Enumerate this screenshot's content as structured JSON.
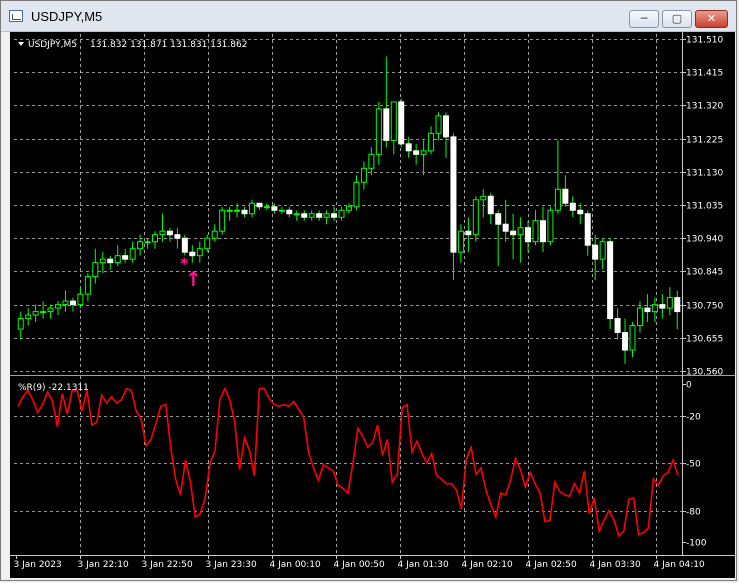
{
  "window": {
    "title": "USDJPY,M5",
    "buttons": {
      "minimize": "─",
      "maximize": "▢",
      "close": "✕"
    }
  },
  "chart_header": {
    "symbol": "USDJPY,M5",
    "ohlc": "131.832 131.871 131.831 131.862"
  },
  "indicator": {
    "label": "%R(9) -22.1311"
  },
  "colors": {
    "background": "#000000",
    "grid": "#c8c8c8",
    "candle": "#00ff00",
    "indicator_line": "#ff0000",
    "signal": "#ff1493"
  },
  "signal": {
    "star_glyph": "*",
    "arrow_glyph": "↑"
  },
  "chart_data": [
    {
      "type": "candlestick",
      "title": "USDJPY,M5",
      "ylim": [
        130.56,
        131.51
      ],
      "y_ticks": [
        "131.510",
        "131.415",
        "131.320",
        "131.225",
        "131.130",
        "131.035",
        "130.940",
        "130.845",
        "130.750",
        "130.655",
        "130.560"
      ],
      "x_ticks": [
        "3 Jan 2023",
        "3 Jan 22:10",
        "3 Jan 22:50",
        "3 Jan 23:30",
        "4 Jan 00:10",
        "4 Jan 00:50",
        "4 Jan 01:30",
        "4 Jan 02:10",
        "4 Jan 02:50",
        "4 Jan 03:30",
        "4 Jan 04:10"
      ],
      "candles": [
        {
          "o": 130.68,
          "h": 130.73,
          "l": 130.65,
          "c": 130.71
        },
        {
          "o": 130.71,
          "h": 130.74,
          "l": 130.69,
          "c": 130.72
        },
        {
          "o": 130.72,
          "h": 130.75,
          "l": 130.7,
          "c": 130.73
        },
        {
          "o": 130.73,
          "h": 130.76,
          "l": 130.71,
          "c": 130.73
        },
        {
          "o": 130.73,
          "h": 130.75,
          "l": 130.71,
          "c": 130.74
        },
        {
          "o": 130.74,
          "h": 130.76,
          "l": 130.72,
          "c": 130.75
        },
        {
          "o": 130.75,
          "h": 130.79,
          "l": 130.73,
          "c": 130.76
        },
        {
          "o": 130.76,
          "h": 130.77,
          "l": 130.73,
          "c": 130.75
        },
        {
          "o": 130.75,
          "h": 130.8,
          "l": 130.74,
          "c": 130.78
        },
        {
          "o": 130.78,
          "h": 130.84,
          "l": 130.76,
          "c": 130.83
        },
        {
          "o": 130.83,
          "h": 130.91,
          "l": 130.81,
          "c": 130.87
        },
        {
          "o": 130.87,
          "h": 130.9,
          "l": 130.84,
          "c": 130.88
        },
        {
          "o": 130.88,
          "h": 130.89,
          "l": 130.85,
          "c": 130.87
        },
        {
          "o": 130.87,
          "h": 130.92,
          "l": 130.86,
          "c": 130.89
        },
        {
          "o": 130.89,
          "h": 130.91,
          "l": 130.87,
          "c": 130.88
        },
        {
          "o": 130.88,
          "h": 130.93,
          "l": 130.87,
          "c": 130.91
        },
        {
          "o": 130.91,
          "h": 130.95,
          "l": 130.89,
          "c": 130.93
        },
        {
          "o": 130.93,
          "h": 130.94,
          "l": 130.91,
          "c": 130.93
        },
        {
          "o": 130.93,
          "h": 130.96,
          "l": 130.91,
          "c": 130.95
        },
        {
          "o": 130.95,
          "h": 131.01,
          "l": 130.93,
          "c": 130.96
        },
        {
          "o": 130.96,
          "h": 130.97,
          "l": 130.93,
          "c": 130.95
        },
        {
          "o": 130.95,
          "h": 130.97,
          "l": 130.91,
          "c": 130.94
        },
        {
          "o": 130.94,
          "h": 130.95,
          "l": 130.89,
          "c": 130.9
        },
        {
          "o": 130.9,
          "h": 130.92,
          "l": 130.87,
          "c": 130.89
        },
        {
          "o": 130.89,
          "h": 130.93,
          "l": 130.87,
          "c": 130.91
        },
        {
          "o": 130.91,
          "h": 130.95,
          "l": 130.9,
          "c": 130.94
        },
        {
          "o": 130.94,
          "h": 130.98,
          "l": 130.93,
          "c": 130.96
        },
        {
          "o": 130.96,
          "h": 131.03,
          "l": 130.95,
          "c": 131.02
        },
        {
          "o": 131.02,
          "h": 131.03,
          "l": 130.99,
          "c": 131.02
        },
        {
          "o": 131.02,
          "h": 131.04,
          "l": 131.0,
          "c": 131.02
        },
        {
          "o": 131.02,
          "h": 131.03,
          "l": 131.0,
          "c": 131.01
        },
        {
          "o": 131.01,
          "h": 131.05,
          "l": 131.0,
          "c": 131.04
        },
        {
          "o": 131.04,
          "h": 131.04,
          "l": 131.02,
          "c": 131.03
        },
        {
          "o": 131.03,
          "h": 131.04,
          "l": 131.02,
          "c": 131.03
        },
        {
          "o": 131.03,
          "h": 131.04,
          "l": 131.01,
          "c": 131.02
        },
        {
          "o": 131.02,
          "h": 131.03,
          "l": 131.01,
          "c": 131.02
        },
        {
          "o": 131.02,
          "h": 131.03,
          "l": 131.0,
          "c": 131.01
        },
        {
          "o": 131.01,
          "h": 131.02,
          "l": 130.99,
          "c": 131.01
        },
        {
          "o": 131.01,
          "h": 131.02,
          "l": 130.99,
          "c": 131.0
        },
        {
          "o": 131.0,
          "h": 131.02,
          "l": 130.99,
          "c": 131.01
        },
        {
          "o": 131.01,
          "h": 131.02,
          "l": 130.99,
          "c": 131.0
        },
        {
          "o": 131.0,
          "h": 131.02,
          "l": 130.98,
          "c": 131.01
        },
        {
          "o": 131.01,
          "h": 131.03,
          "l": 130.99,
          "c": 131.0
        },
        {
          "o": 131.0,
          "h": 131.03,
          "l": 130.99,
          "c": 131.02
        },
        {
          "o": 131.02,
          "h": 131.04,
          "l": 131.01,
          "c": 131.03
        },
        {
          "o": 131.03,
          "h": 131.12,
          "l": 131.02,
          "c": 131.1
        },
        {
          "o": 131.1,
          "h": 131.16,
          "l": 131.08,
          "c": 131.14
        },
        {
          "o": 131.14,
          "h": 131.2,
          "l": 131.12,
          "c": 131.18
        },
        {
          "o": 131.18,
          "h": 131.33,
          "l": 131.15,
          "c": 131.31
        },
        {
          "o": 131.31,
          "h": 131.46,
          "l": 131.2,
          "c": 131.22
        },
        {
          "o": 131.22,
          "h": 131.33,
          "l": 131.18,
          "c": 131.33
        },
        {
          "o": 131.33,
          "h": 131.34,
          "l": 131.2,
          "c": 131.21
        },
        {
          "o": 131.21,
          "h": 131.23,
          "l": 131.17,
          "c": 131.19
        },
        {
          "o": 131.19,
          "h": 131.21,
          "l": 131.15,
          "c": 131.18
        },
        {
          "o": 131.18,
          "h": 131.22,
          "l": 131.12,
          "c": 131.19
        },
        {
          "o": 131.19,
          "h": 131.26,
          "l": 131.18,
          "c": 131.24
        },
        {
          "o": 131.24,
          "h": 131.3,
          "l": 131.22,
          "c": 131.29
        },
        {
          "o": 131.29,
          "h": 131.3,
          "l": 131.17,
          "c": 131.23
        },
        {
          "o": 131.23,
          "h": 131.24,
          "l": 130.82,
          "c": 130.9
        },
        {
          "o": 130.9,
          "h": 130.98,
          "l": 130.87,
          "c": 130.96
        },
        {
          "o": 130.96,
          "h": 131.0,
          "l": 130.9,
          "c": 130.95
        },
        {
          "o": 130.95,
          "h": 131.06,
          "l": 130.93,
          "c": 131.05
        },
        {
          "o": 131.05,
          "h": 131.08,
          "l": 131.0,
          "c": 131.06
        },
        {
          "o": 131.06,
          "h": 131.07,
          "l": 130.98,
          "c": 131.01
        },
        {
          "o": 131.01,
          "h": 131.02,
          "l": 130.86,
          "c": 130.98
        },
        {
          "o": 130.98,
          "h": 131.05,
          "l": 130.93,
          "c": 130.96
        },
        {
          "o": 130.96,
          "h": 131.01,
          "l": 130.88,
          "c": 130.95
        },
        {
          "o": 130.95,
          "h": 131.0,
          "l": 130.87,
          "c": 130.97
        },
        {
          "o": 130.97,
          "h": 130.99,
          "l": 130.9,
          "c": 130.93
        },
        {
          "o": 130.93,
          "h": 131.02,
          "l": 130.92,
          "c": 130.99
        },
        {
          "o": 130.99,
          "h": 131.03,
          "l": 130.9,
          "c": 130.93
        },
        {
          "o": 130.93,
          "h": 131.03,
          "l": 130.92,
          "c": 131.02
        },
        {
          "o": 131.02,
          "h": 131.22,
          "l": 131.01,
          "c": 131.08
        },
        {
          "o": 131.08,
          "h": 131.12,
          "l": 131.03,
          "c": 131.04
        },
        {
          "o": 131.04,
          "h": 131.06,
          "l": 131.0,
          "c": 131.02
        },
        {
          "o": 131.02,
          "h": 131.04,
          "l": 130.98,
          "c": 131.01
        },
        {
          "o": 131.01,
          "h": 131.02,
          "l": 130.89,
          "c": 130.92
        },
        {
          "o": 130.92,
          "h": 130.95,
          "l": 130.82,
          "c": 130.88
        },
        {
          "o": 130.88,
          "h": 130.94,
          "l": 130.85,
          "c": 130.93
        },
        {
          "o": 130.93,
          "h": 130.94,
          "l": 130.68,
          "c": 130.71
        },
        {
          "o": 130.71,
          "h": 130.74,
          "l": 130.65,
          "c": 130.67
        },
        {
          "o": 130.67,
          "h": 130.71,
          "l": 130.58,
          "c": 130.62
        },
        {
          "o": 130.62,
          "h": 130.7,
          "l": 130.6,
          "c": 130.69
        },
        {
          "o": 130.69,
          "h": 130.76,
          "l": 130.67,
          "c": 130.74
        },
        {
          "o": 130.74,
          "h": 130.78,
          "l": 130.7,
          "c": 130.73
        },
        {
          "o": 130.73,
          "h": 130.77,
          "l": 130.7,
          "c": 130.75
        },
        {
          "o": 130.75,
          "h": 130.78,
          "l": 130.71,
          "c": 130.74
        },
        {
          "o": 130.74,
          "h": 130.8,
          "l": 130.72,
          "c": 130.77
        },
        {
          "o": 130.77,
          "h": 130.79,
          "l": 130.68,
          "c": 130.73
        }
      ]
    },
    {
      "type": "line",
      "title": "%R(9) -22.1311",
      "ylim": [
        -103,
        0
      ],
      "y_ticks": [
        "0",
        "-20",
        "-50",
        "-80",
        "-100"
      ],
      "series": [
        {
          "name": "%R(9)",
          "values": [
            -14,
            -8,
            -4,
            -10,
            -18,
            -13,
            -5,
            -11,
            -27,
            -6,
            -19,
            -4,
            -4,
            -17,
            -4,
            -26,
            -24,
            -7,
            -12,
            -8,
            -12,
            -10,
            -3,
            -4,
            -17,
            -22,
            -39,
            -35,
            -25,
            -14,
            -13,
            -40,
            -60,
            -70,
            -48,
            -62,
            -84,
            -82,
            -72,
            -50,
            -42,
            -10,
            -3,
            -10,
            -24,
            -54,
            -34,
            -42,
            -58,
            -3,
            -3,
            -9,
            -13,
            -14,
            -13,
            -14,
            -11,
            -16,
            -21,
            -43,
            -53,
            -61,
            -51,
            -53,
            -55,
            -64,
            -66,
            -69,
            -50,
            -28,
            -33,
            -40,
            -37,
            -26,
            -45,
            -35,
            -62,
            -57,
            -15,
            -13,
            -43,
            -36,
            -44,
            -50,
            -44,
            -58,
            -60,
            -63,
            -63,
            -67,
            -79,
            -48,
            -40,
            -57,
            -53,
            -67,
            -76,
            -84,
            -69,
            -70,
            -61,
            -47,
            -54,
            -65,
            -56,
            -63,
            -69,
            -87,
            -86,
            -62,
            -68,
            -70,
            -71,
            -63,
            -69,
            -55,
            -82,
            -72,
            -93,
            -86,
            -80,
            -86,
            -96,
            -93,
            -73,
            -72,
            -95,
            -94,
            -91,
            -60,
            -64,
            -58,
            -56,
            -48,
            -58
          ]
        }
      ]
    }
  ]
}
